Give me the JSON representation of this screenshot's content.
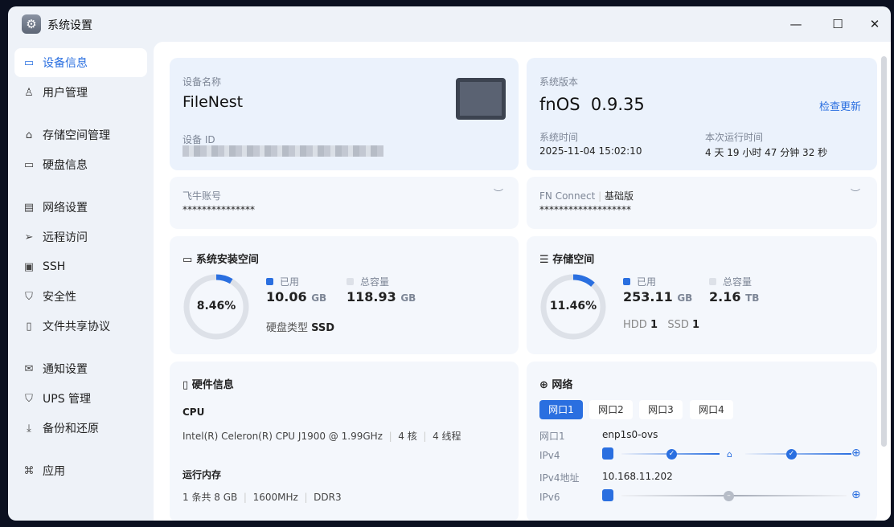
{
  "window": {
    "title": "系统设置",
    "controls": [
      "minimize",
      "maximize",
      "close"
    ]
  },
  "sidebar": {
    "items": [
      {
        "label": "设备信息",
        "icon": "drive-icon",
        "active": true
      },
      {
        "label": "用户管理",
        "icon": "users-icon"
      },
      {
        "label": "存储空间管理",
        "icon": "storage-icon"
      },
      {
        "label": "硬盘信息",
        "icon": "disk-icon"
      },
      {
        "label": "网络设置",
        "icon": "network-icon"
      },
      {
        "label": "远程访问",
        "icon": "send-icon"
      },
      {
        "label": "SSH",
        "icon": "terminal-icon"
      },
      {
        "label": "安全性",
        "icon": "shield-icon"
      },
      {
        "label": "文件共享协议",
        "icon": "file-icon"
      },
      {
        "label": "通知设置",
        "icon": "mail-icon"
      },
      {
        "label": "UPS 管理",
        "icon": "ups-icon"
      },
      {
        "label": "备份和还原",
        "icon": "backup-icon"
      },
      {
        "label": "应用",
        "icon": "apps-icon"
      }
    ]
  },
  "device": {
    "name_label": "设备名称",
    "name": "FileNest",
    "id_label": "设备 ID"
  },
  "system": {
    "version_label": "系统版本",
    "os": "fnOS",
    "version": "0.9.35",
    "check_update": "检查更新",
    "time_label": "系统时间",
    "time": "2025-11-04 15:02:10",
    "uptime_label": "本次运行时间",
    "uptime": "4 天 19 小时 47 分钟 32 秒"
  },
  "account": {
    "label": "飞牛账号",
    "value": "***************"
  },
  "fnconnect": {
    "label": "FN Connect",
    "tier": "基础版",
    "value": "*******************"
  },
  "install_space": {
    "title": "系统安装空间",
    "percent": "8.46%",
    "fraction": 0.0846,
    "used_label": "已用",
    "used": "10.06",
    "used_unit": "GB",
    "total_label": "总容量",
    "total": "118.93",
    "total_unit": "GB",
    "disk_type_label": "硬盘类型",
    "disk_type": "SSD"
  },
  "storage": {
    "title": "存储空间",
    "percent": "11.46%",
    "fraction": 0.1146,
    "used_label": "已用",
    "used": "253.11",
    "used_unit": "GB",
    "total_label": "总容量",
    "total": "2.16",
    "total_unit": "TB",
    "hdd_label": "HDD",
    "hdd": "1",
    "ssd_label": "SSD",
    "ssd": "1"
  },
  "hardware": {
    "title": "硬件信息",
    "cpu_label": "CPU",
    "cpu": "Intel(R) Celeron(R) CPU J1900 @ 1.99GHz",
    "cores": "4 核",
    "threads": "4 线程",
    "mem_label": "运行内存",
    "mem": "1 条共 8 GB",
    "mem_freq": "1600MHz",
    "mem_type": "DDR3"
  },
  "network": {
    "title": "网络",
    "tabs": [
      "网口1",
      "网口2",
      "网口3",
      "网口4"
    ],
    "active_tab": 0,
    "port_label": "网口1",
    "port": "enp1s0-ovs",
    "ipv4_label": "IPv4",
    "ipv4_addr_label": "IPv4地址",
    "ipv4_addr": "10.168.11.202",
    "ipv6_label": "IPv6"
  },
  "colors": {
    "accent": "#2a6fe0",
    "ring_track": "#dde1e8"
  }
}
